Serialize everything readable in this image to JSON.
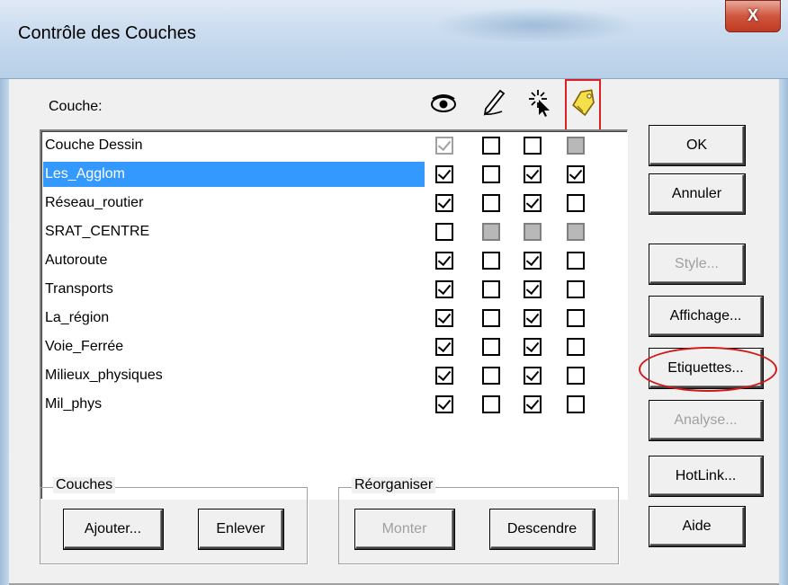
{
  "window": {
    "title": "Contrôle des Couches",
    "close_label": "X"
  },
  "list": {
    "header_label": "Couche:",
    "column_icons": [
      "eye-icon",
      "pencil-icon",
      "select-pointer-icon",
      "label-tag-icon"
    ],
    "layers": [
      {
        "name": "Couche Dessin",
        "visible": "gray-checked",
        "editable": "unchecked",
        "selectable": "unchecked",
        "labeled": "filled"
      },
      {
        "name": "Les_Agglom",
        "selected": true,
        "visible": "checked",
        "editable": "unchecked",
        "selectable": "checked",
        "labeled": "checked"
      },
      {
        "name": "Réseau_routier",
        "visible": "checked",
        "editable": "unchecked",
        "selectable": "checked",
        "labeled": "unchecked"
      },
      {
        "name": "SRAT_CENTRE",
        "visible": "unchecked",
        "editable": "filled",
        "selectable": "filled",
        "labeled": "filled"
      },
      {
        "name": "Autoroute",
        "visible": "checked",
        "editable": "unchecked",
        "selectable": "checked",
        "labeled": "unchecked"
      },
      {
        "name": "Transports",
        "visible": "checked",
        "editable": "unchecked",
        "selectable": "checked",
        "labeled": "unchecked"
      },
      {
        "name": "La_région",
        "visible": "checked",
        "editable": "unchecked",
        "selectable": "checked",
        "labeled": "unchecked"
      },
      {
        "name": "Voie_Ferrée",
        "visible": "checked",
        "editable": "unchecked",
        "selectable": "checked",
        "labeled": "unchecked"
      },
      {
        "name": "Milieux_physiques",
        "visible": "checked",
        "editable": "unchecked",
        "selectable": "checked",
        "labeled": "unchecked"
      },
      {
        "name": "Mil_phys",
        "visible": "checked",
        "editable": "unchecked",
        "selectable": "checked",
        "labeled": "unchecked"
      }
    ]
  },
  "buttons": {
    "ok": "OK",
    "cancel": "Annuler",
    "style": "Style...",
    "display": "Affichage...",
    "labels": "Etiquettes...",
    "analysis": "Analyse...",
    "hotlink": "HotLink...",
    "help": "Aide"
  },
  "groups": {
    "layers": {
      "title": "Couches",
      "add": "Ajouter...",
      "remove": "Enlever"
    },
    "reorder": {
      "title": "Réorganiser",
      "up": "Monter",
      "down": "Descendre"
    }
  },
  "colors": {
    "selection": "#3399ff",
    "annotation": "#e02020"
  }
}
